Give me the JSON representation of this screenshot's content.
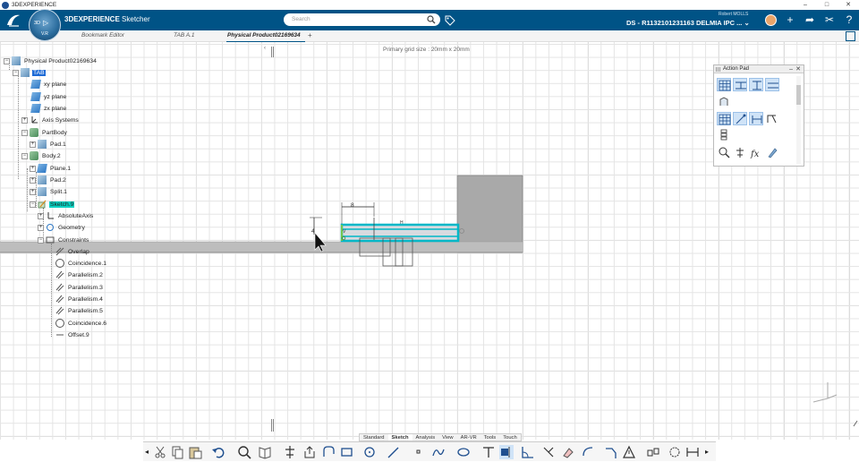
{
  "window": {
    "title": "3DEXPERIENCE",
    "controls": [
      "–",
      "□",
      "✕"
    ]
  },
  "top_bar": {
    "app_label_prefix": "3DEXPERIENCE",
    "app_label_suffix": "Sketcher",
    "compass_3d": "3D",
    "compass_version": "V.R",
    "search_placeholder": "Search",
    "user_name": "Robert MOLLS",
    "collab_space": "DS - R1132101231163 DELMIA IPC ...",
    "brand_color": "#005386"
  },
  "tabs": [
    {
      "label": "Bookmark Editor"
    },
    {
      "label": "TAB A.1"
    },
    {
      "label": "Physical Product02169634"
    }
  ],
  "canvas": {
    "grid_label": "Primary grid size : 20mm x 20mm"
  },
  "tree": {
    "root": "Physical Product02169634",
    "items": [
      {
        "label": "TAB"
      },
      {
        "label": "xy plane"
      },
      {
        "label": "yz plane"
      },
      {
        "label": "zx plane"
      },
      {
        "label": "Axis Systems"
      },
      {
        "label": "PartBody"
      },
      {
        "label": "Pad.1"
      },
      {
        "label": "Body.2"
      },
      {
        "label": "Plane.1"
      },
      {
        "label": "Pad.2"
      },
      {
        "label": "Split.1"
      },
      {
        "label": "Sketch.9"
      },
      {
        "label": "AbsoluteAxis"
      },
      {
        "label": "Geometry"
      },
      {
        "label": "Constraints"
      },
      {
        "label": "Overlap"
      },
      {
        "label": "Coincidence.1"
      },
      {
        "label": "Parallelism.2"
      },
      {
        "label": "Parallelism.3"
      },
      {
        "label": "Parallelism.4"
      },
      {
        "label": "Parallelism.5"
      },
      {
        "label": "Coincidence.6"
      },
      {
        "label": "Offset.9"
      }
    ]
  },
  "sketch": {
    "dim_horizontal": "8",
    "dim_vertical": "4",
    "label_h": "H",
    "label_v": "V"
  },
  "action_pad": {
    "title": "Action Pad"
  },
  "section_tabs": [
    "Standard",
    "Sketch",
    "Analysis",
    "View",
    "AR-VR",
    "Tools",
    "Touch"
  ],
  "active_section": "Sketch"
}
